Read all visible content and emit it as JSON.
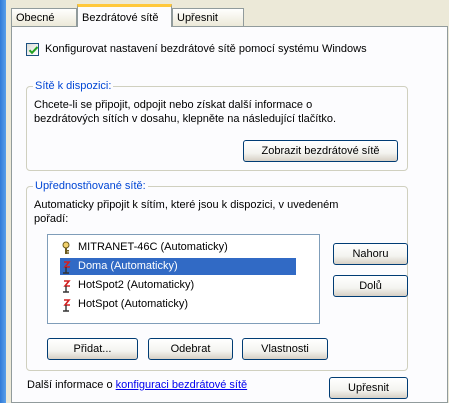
{
  "tabs": [
    {
      "label": "Obecné",
      "active": false
    },
    {
      "label": "Bezdrátové sítě",
      "active": true
    },
    {
      "label": "Upřesnit",
      "active": false
    }
  ],
  "configure_checkbox": {
    "label": "Konfigurovat nastavení bezdrátové sítě pomocí systému Windows",
    "checked": true
  },
  "available_networks": {
    "legend": "Sítě k dispozici:",
    "description_line1": "Chcete-li se připojit, odpojit nebo získat další informace o",
    "description_line2": "bezdrátových sítích v dosahu, klepněte na následující tlačítko.",
    "show_button": "Zobrazit bezdrátové sítě"
  },
  "preferred_networks": {
    "legend": "Upřednostňované sítě:",
    "description_line1": "Automaticky připojit k sítím, které jsou k dispozici, v uvedeném",
    "description_line2": "pořadí:",
    "items": [
      {
        "label": "MITRANET-46C (Automaticky)",
        "icon": "network-key-icon",
        "selected": false
      },
      {
        "label": "Doma (Automaticky)",
        "icon": "wireless-antenna-icon",
        "selected": true
      },
      {
        "label": "HotSpot2 (Automaticky)",
        "icon": "wireless-antenna-icon",
        "selected": false
      },
      {
        "label": "HotSpot (Automaticky)",
        "icon": "wireless-antenna-icon",
        "selected": false
      }
    ],
    "up_button": "Nahoru",
    "down_button": "Dolů",
    "add_button": "Přidat...",
    "remove_button": "Odebrat",
    "properties_button": "Vlastnosti"
  },
  "footer": {
    "text_prefix": "Další informace o ",
    "link_text": "konfiguraci bezdrátové sítě",
    "advanced_button": "Upřesnit"
  },
  "colors": {
    "accent_legend": "#0046d5",
    "selection": "#316ac5",
    "active_tab_highlight": "#ffc83c",
    "frame_blue": "#2a73c9"
  }
}
